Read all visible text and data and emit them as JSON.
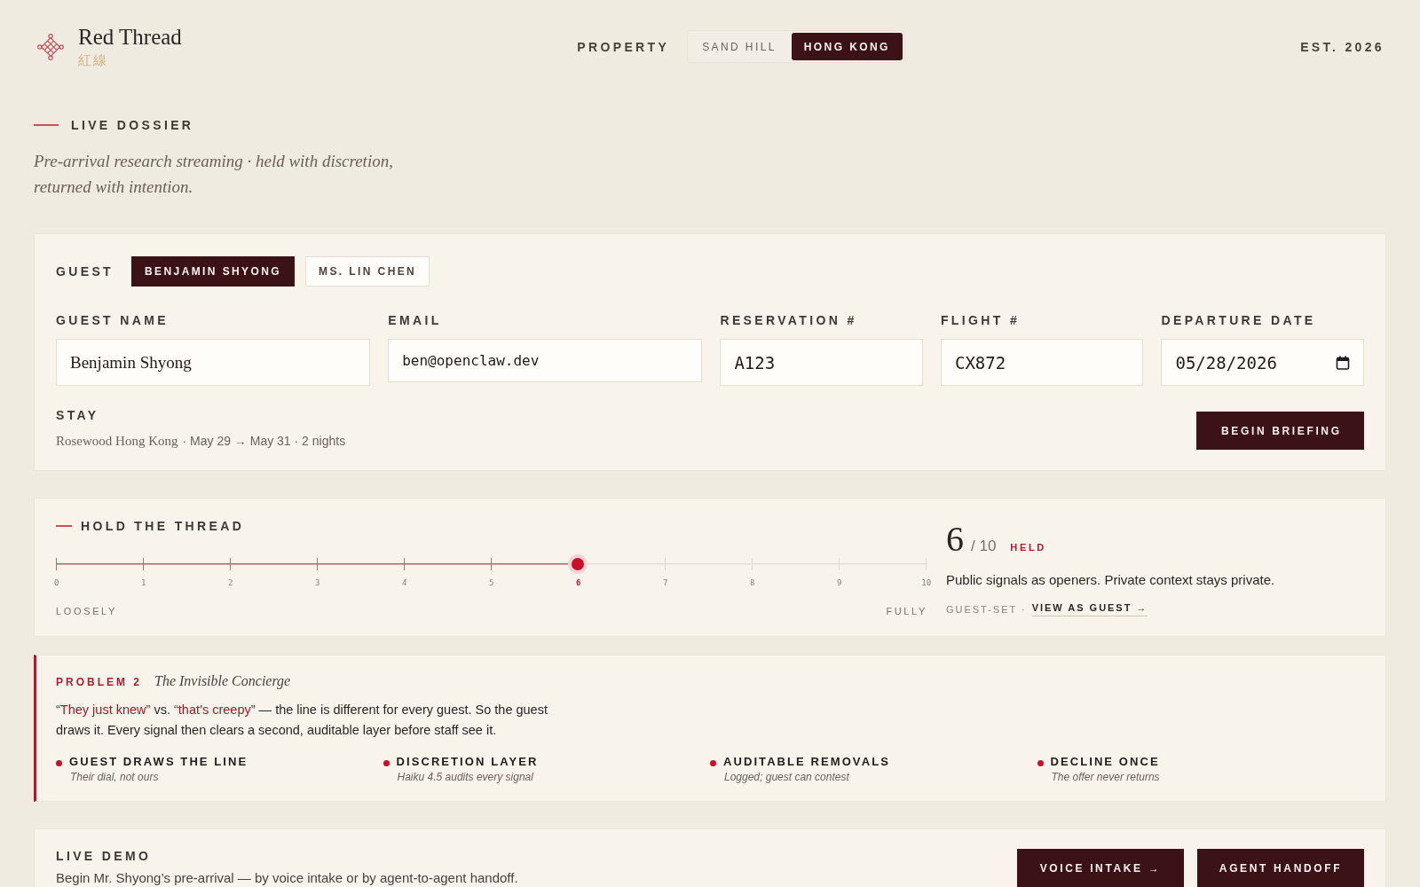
{
  "header": {
    "brand": {
      "name": "Red Thread",
      "name_cn": "紅線"
    },
    "property": {
      "label": "PROPERTY",
      "options": [
        {
          "label": "SAND HILL",
          "selected": false
        },
        {
          "label": "HONG KONG",
          "selected": true
        }
      ]
    },
    "established": "EST. 2026"
  },
  "intro": {
    "kicker": "LIVE DOSSIER",
    "tagline": "Pre-arrival research streaming · held with discretion, returned with intention."
  },
  "guest_card": {
    "guest_label": "GUEST",
    "guests": [
      {
        "label": "BENJAMIN SHYONG",
        "selected": true
      },
      {
        "label": "MS. LIN CHEN",
        "selected": false
      }
    ],
    "fields": [
      {
        "label": "GUEST NAME",
        "kind": "text",
        "value": "Benjamin Shyong"
      },
      {
        "label": "EMAIL",
        "kind": "email",
        "value": "ben@openclaw.dev"
      },
      {
        "label": "RESERVATION #",
        "kind": "code",
        "value": "A123"
      },
      {
        "label": "FLIGHT #",
        "kind": "code",
        "value": "CX872"
      },
      {
        "label": "DEPARTURE DATE",
        "kind": "date",
        "value": "05/28/2026"
      }
    ],
    "stay": {
      "label": "STAY",
      "hotel": "Rosewood Hong Kong",
      "details": "· May 29 → May 31 · 2 nights"
    },
    "action": "BEGIN BRIEFING"
  },
  "thread_card": {
    "title": "HOLD THE THREAD",
    "slider": {
      "level": 0.6,
      "ticks": [
        {
          "label": "0",
          "selected": false
        },
        {
          "label": "1",
          "selected": false
        },
        {
          "label": "2",
          "selected": false
        },
        {
          "label": "3",
          "selected": false
        },
        {
          "label": "4",
          "selected": false
        },
        {
          "label": "5",
          "selected": false
        },
        {
          "label": "6",
          "selected": true
        },
        {
          "label": "7",
          "selected": false
        },
        {
          "label": "8",
          "selected": false
        },
        {
          "label": "9",
          "selected": false
        },
        {
          "label": "10",
          "selected": false
        }
      ],
      "min_label": "LOOSELY",
      "max_label": "FULLY"
    },
    "reading": {
      "value": "6",
      "scale": "/ 10",
      "status": "HELD"
    },
    "description": "Public signals as openers. Private context stays private.",
    "source": "GUEST-SET ·",
    "link": "VIEW AS GUEST →"
  },
  "problem_card": {
    "kicker": "PROBLEM 2",
    "title": "The Invisible Concierge",
    "body": "**“They just knew”** vs. **“that’s creepy”** — the line is different for every guest. So the guest draws it. Every signal then clears a second, auditable layer before staff see it.",
    "points": [
      {
        "title": "GUEST DRAWS THE LINE",
        "note": "Their dial, not ours"
      },
      {
        "title": "DISCRETION LAYER",
        "note": "Haiku 4.5 audits every signal"
      },
      {
        "title": "AUDITABLE REMOVALS",
        "note": "Logged; guest can contest"
      },
      {
        "title": "DECLINE ONCE",
        "note": "The offer never returns"
      }
    ]
  },
  "demo_card": {
    "title": "LIVE DEMO",
    "description": "Begin Mr. Shyong’s pre-arrival — by voice intake or by agent-to-agent handoff.",
    "buttons": [
      "VOICE INTAKE →",
      "AGENT HANDOFF"
    ]
  }
}
